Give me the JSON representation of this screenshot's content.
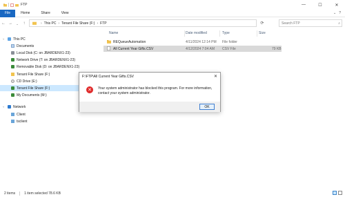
{
  "window": {
    "title": "FTP",
    "controls": {
      "minimize": "—",
      "maximize": "☐",
      "close": "✕"
    }
  },
  "menu": {
    "file": "File",
    "home": "Home",
    "share": "Share",
    "view": "View"
  },
  "address": {
    "crumbs": [
      "This PC",
      "Tenant File Share (F:)",
      "FTP"
    ],
    "search_placeholder": "Search FTP"
  },
  "nav": {
    "items": [
      {
        "label": "This PC",
        "icon": "pc-icon"
      },
      {
        "label": "Documents",
        "icon": "documents-icon"
      },
      {
        "label": "Local Disk (C: on JBARDENX1-23)",
        "icon": "drive-icon"
      },
      {
        "label": "Network Drive (T: on JBARDENX1-23)",
        "icon": "network-drive-icon"
      },
      {
        "label": "Removable Disk (D: on JBARDENX1-23)",
        "icon": "removable-drive-icon"
      },
      {
        "label": "Tenant File Share (F:)",
        "icon": "folder-icon"
      },
      {
        "label": "CD Drive (E:)",
        "icon": "cd-drive-icon"
      },
      {
        "label": "Tenant File Share (F:)",
        "icon": "network-drive-icon"
      },
      {
        "label": "My Documents (M:)",
        "icon": "network-drive-icon"
      },
      {
        "label": "Network",
        "icon": "network-icon"
      },
      {
        "label": "Client",
        "icon": "computer-icon"
      },
      {
        "label": "tsclient",
        "icon": "computer-icon"
      }
    ]
  },
  "columns": {
    "name": "Name",
    "date_modified": "Date modified",
    "type": "Type",
    "size": "Size"
  },
  "files": [
    {
      "name": "REQueueAutomation",
      "date": "4/11/2024 12:14 PM",
      "type": "File folder",
      "size": ""
    },
    {
      "name": "All Current Year Gifts.CSV",
      "date": "4/12/2024 7:04 AM",
      "type": "CSV File",
      "size": "79 KB"
    }
  ],
  "status": {
    "items": "2 items",
    "selected": "1 item selected  78.6 KB"
  },
  "dialog": {
    "title": "F:\\FTP\\All Current Year Gifts.CSV",
    "close": "✕",
    "error_glyph": "✕",
    "message": "Your system administrator has blocked this program. For more information, contact your system administrator.",
    "ok_label": "OK"
  }
}
